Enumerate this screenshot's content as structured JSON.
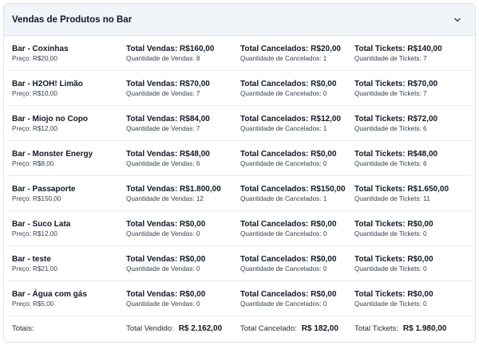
{
  "panel": {
    "title": "Vendas de Produtos no Bar"
  },
  "products": [
    {
      "name": "Bar - Coxinhas",
      "price": "Preço: R$20,00",
      "sales_total": "Total Vendas: R$160,00",
      "sales_qty": "Quantidade de Vendas: 8",
      "cancel_total": "Total Cancelados: R$20,00",
      "cancel_qty": "Quantidade de Cancelados: 1",
      "tickets_total": "Total Tickets: R$140,00",
      "tickets_qty": "Quantidade de Tickets: 7"
    },
    {
      "name": "Bar - H2OH! Limão",
      "price": "Preço: R$10,00",
      "sales_total": "Total Vendas: R$70,00",
      "sales_qty": "Quantidade de Vendas: 7",
      "cancel_total": "Total Cancelados: R$0,00",
      "cancel_qty": "Quantidade de Cancelados: 0",
      "tickets_total": "Total Tickets: R$70,00",
      "tickets_qty": "Quantidade de Tickets: 7"
    },
    {
      "name": "Bar - Miojo no Copo",
      "price": "Preço: R$12,00",
      "sales_total": "Total Vendas: R$84,00",
      "sales_qty": "Quantidade de Vendas: 7",
      "cancel_total": "Total Cancelados: R$12,00",
      "cancel_qty": "Quantidade de Cancelados: 1",
      "tickets_total": "Total Tickets: R$72,00",
      "tickets_qty": "Quantidade de Tickets: 6"
    },
    {
      "name": "Bar - Monster Energy",
      "price": "Preço: R$8,00",
      "sales_total": "Total Vendas: R$48,00",
      "sales_qty": "Quantidade de Vendas: 6",
      "cancel_total": "Total Cancelados: R$0,00",
      "cancel_qty": "Quantidade de Cancelados: 0",
      "tickets_total": "Total Tickets: R$48,00",
      "tickets_qty": "Quantidade de Tickets: 6"
    },
    {
      "name": "Bar - Passaporte",
      "price": "Preço: R$150,00",
      "sales_total": "Total Vendas: R$1.800,00",
      "sales_qty": "Quantidade de Vendas: 12",
      "cancel_total": "Total Cancelados: R$150,00",
      "cancel_qty": "Quantidade de Cancelados: 1",
      "tickets_total": "Total Tickets: R$1.650,00",
      "tickets_qty": "Quantidade de Tickets: 11"
    },
    {
      "name": "Bar - Suco Lata",
      "price": "Preço: R$12,00",
      "sales_total": "Total Vendas: R$0,00",
      "sales_qty": "Quantidade de Vendas: 0",
      "cancel_total": "Total Cancelados: R$0,00",
      "cancel_qty": "Quantidade de Cancelados: 0",
      "tickets_total": "Total Tickets: R$0,00",
      "tickets_qty": "Quantidade de Tickets: 0"
    },
    {
      "name": "Bar - teste",
      "price": "Preço: R$21,00",
      "sales_total": "Total Vendas: R$0,00",
      "sales_qty": "Quantidade de Vendas: 0",
      "cancel_total": "Total Cancelados: R$0,00",
      "cancel_qty": "Quantidade de Cancelados: 0",
      "tickets_total": "Total Tickets: R$0,00",
      "tickets_qty": "Quantidade de Tickets: 0"
    },
    {
      "name": "Bar - Água com gás",
      "price": "Preço: R$5,00",
      "sales_total": "Total Vendas: R$0,00",
      "sales_qty": "Quantidade de Vendas: 0",
      "cancel_total": "Total Cancelados: R$0,00",
      "cancel_qty": "Quantidade de Cancelados: 0",
      "tickets_total": "Total Tickets: R$0,00",
      "tickets_qty": "Quantidade de Tickets: 0"
    }
  ],
  "totals": {
    "label": "Totais:",
    "sold_label": "Total Vendido:",
    "sold_value": "R$ 2.162,00",
    "cancelled_label": "Total Cancelado:",
    "cancelled_value": "R$ 182,00",
    "tickets_label": "Total Tickets:",
    "tickets_value": "R$ 1.980,00"
  },
  "icons": {
    "collapse": "chevron-down-icon"
  },
  "colors": {
    "header_bg": "#f1f5fa",
    "border": "#dfe3ea",
    "text": "#111827"
  }
}
